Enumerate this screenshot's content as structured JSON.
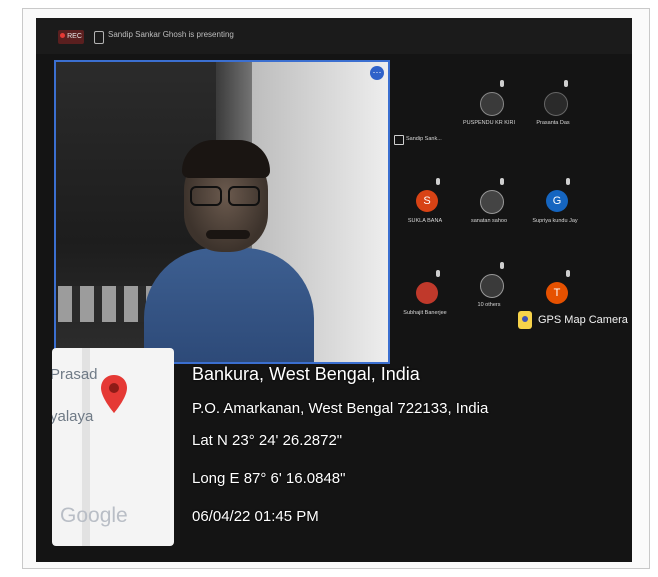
{
  "meeting": {
    "rec_label": "REC",
    "presenting_text": "Sandip Sankar Ghosh is presenting"
  },
  "participants": [
    {
      "name": "Sandip Sank...",
      "initial": "",
      "color": ""
    },
    {
      "name": "PUSPENDU KR KIRI",
      "initial": "",
      "color": "#3a3a3a"
    },
    {
      "name": "Prasanta Das",
      "initial": "",
      "color": "#2a2a2a"
    },
    {
      "name": "SUKLA BANA",
      "initial": "S",
      "color": "#d84315"
    },
    {
      "name": "sanatan sahoo",
      "initial": "",
      "color": "#444444"
    },
    {
      "name": "Supriya kundu Jay",
      "initial": "G",
      "color": "#1565c0"
    },
    {
      "name": "Subhajit Banerjee",
      "initial": "",
      "color": "#c0392b"
    },
    {
      "name": "10 others",
      "initial": "",
      "color": "#3a3a3a"
    },
    {
      "name": "",
      "initial": "T",
      "color": "#e65100"
    }
  ],
  "gps": {
    "camera_label": "GPS Map Camera",
    "map_label_1": "Prasad",
    "map_label_2": "yalaya",
    "google": "Google",
    "city": "Bankura, West Bengal, India",
    "address": "P.O. Amarkanan, West Bengal 722133, India",
    "lat": "Lat N 23° 24' 26.2872\"",
    "long": "Long E 87° 6' 16.0848\"",
    "datetime": "06/04/22 01:45 PM"
  },
  "colors": {
    "active_speaker_border": "#3b6fd0",
    "map_pin": "#e53935"
  },
  "icons": [
    "record-icon",
    "screen-share-icon",
    "more-options-icon",
    "microphone-icon",
    "map-pin-icon",
    "gps-camera-icon"
  ]
}
